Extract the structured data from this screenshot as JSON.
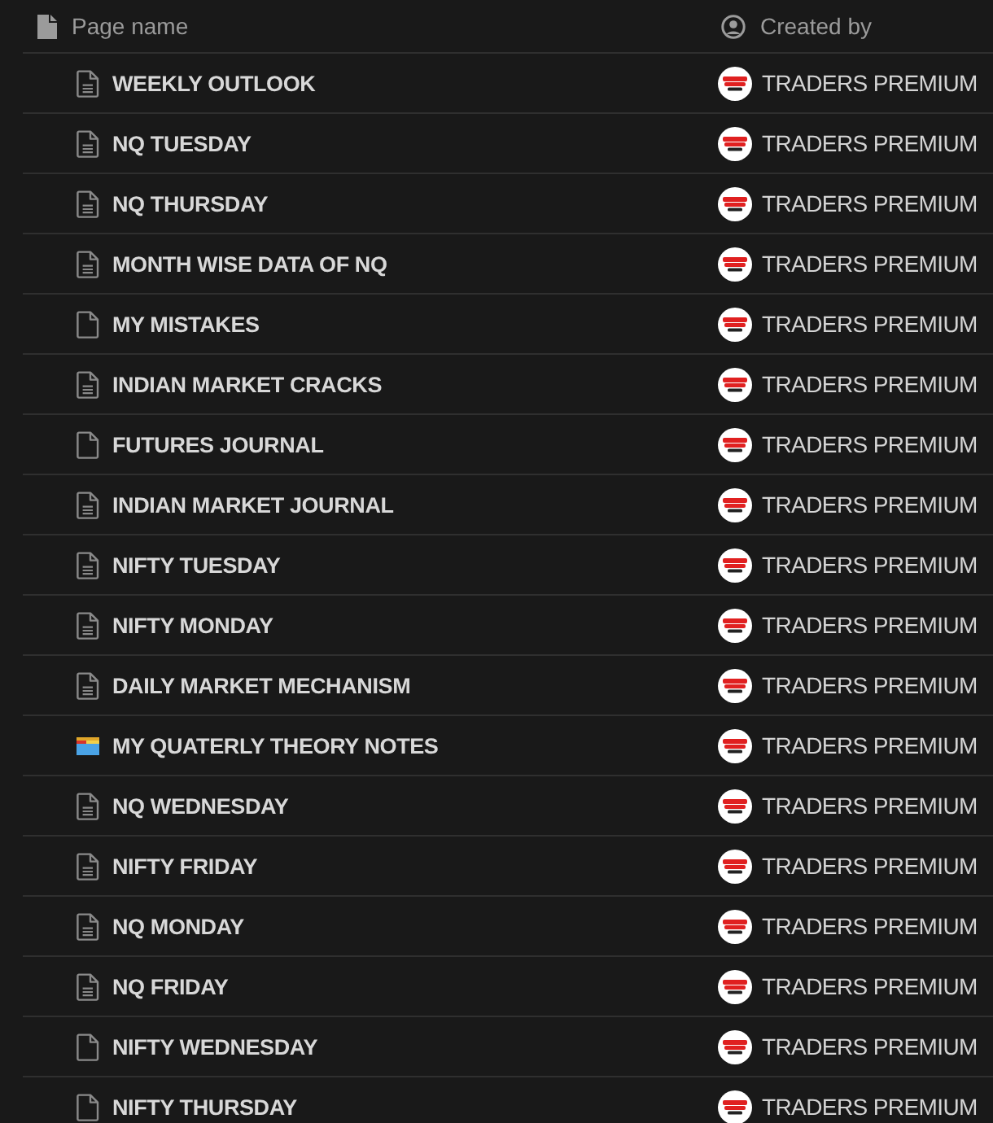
{
  "columns": [
    {
      "kind": "title",
      "label": "Page name"
    },
    {
      "kind": "person",
      "label": "Created by"
    }
  ],
  "rows": [
    {
      "kind": "document",
      "title": "WEEKLY OUTLOOK",
      "creator": "TRADERS PREMIUM"
    },
    {
      "kind": "document",
      "title": "NQ TUESDAY",
      "creator": "TRADERS PREMIUM"
    },
    {
      "kind": "document",
      "title": "NQ THURSDAY",
      "creator": "TRADERS PREMIUM"
    },
    {
      "kind": "document",
      "title": "MONTH WISE DATA OF NQ",
      "creator": "TRADERS PREMIUM"
    },
    {
      "kind": "blank",
      "title": "MY MISTAKES",
      "creator": "TRADERS PREMIUM"
    },
    {
      "kind": "document",
      "title": "INDIAN MARKET CRACKS",
      "creator": "TRADERS PREMIUM"
    },
    {
      "kind": "blank",
      "title": "FUTURES JOURNAL",
      "creator": "TRADERS PREMIUM"
    },
    {
      "kind": "document",
      "title": "INDIAN MARKET JOURNAL",
      "creator": "TRADERS PREMIUM"
    },
    {
      "kind": "document",
      "title": "NIFTY TUESDAY",
      "creator": "TRADERS PREMIUM"
    },
    {
      "kind": "document",
      "title": "NIFTY MONDAY",
      "creator": "TRADERS PREMIUM"
    },
    {
      "kind": "document",
      "title": "DAILY MARKET MECHANISM",
      "creator": "TRADERS PREMIUM"
    },
    {
      "kind": "picture",
      "title": "MY QUATERLY THEORY NOTES",
      "creator": "TRADERS PREMIUM"
    },
    {
      "kind": "document",
      "title": "NQ WEDNESDAY",
      "creator": "TRADERS PREMIUM"
    },
    {
      "kind": "document",
      "title": "NIFTY FRIDAY",
      "creator": "TRADERS PREMIUM"
    },
    {
      "kind": "document",
      "title": "NQ MONDAY",
      "creator": "TRADERS PREMIUM"
    },
    {
      "kind": "document",
      "title": "NQ FRIDAY",
      "creator": "TRADERS PREMIUM"
    },
    {
      "kind": "blank",
      "title": "NIFTY WEDNESDAY",
      "creator": "TRADERS PREMIUM"
    },
    {
      "kind": "blank",
      "title": "NIFTY THURSDAY",
      "creator": "TRADERS PREMIUM"
    }
  ]
}
